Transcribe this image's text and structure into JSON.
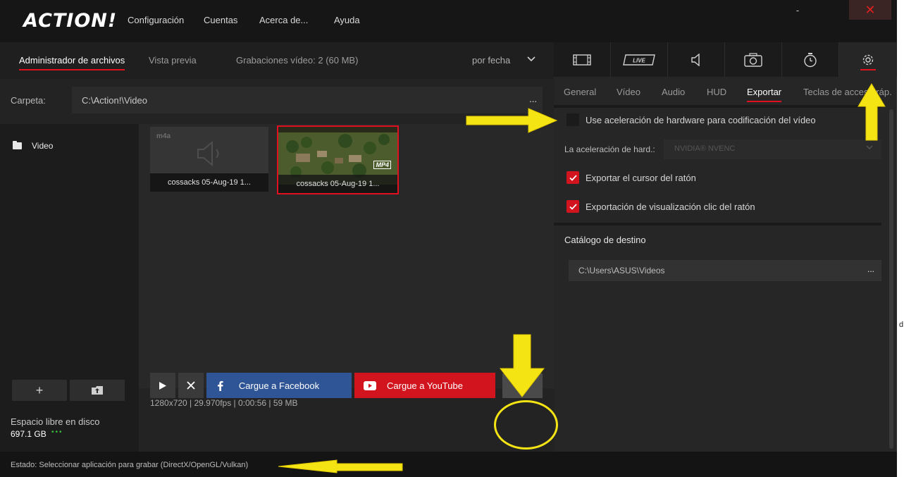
{
  "app": {
    "logo": "ACTION!"
  },
  "menu": [
    "Configuración",
    "Cuentas",
    "Acerca de...",
    "Ayuda"
  ],
  "window": {
    "minimize": "-",
    "close": "✕"
  },
  "left": {
    "tabs": {
      "files": "Administrador de archivos",
      "preview": "Vista previa"
    },
    "recordings_info": "Grabaciones vídeo: 2 (60 MB)",
    "sort": "por fecha",
    "folder_label": "Carpeta:",
    "folder_path": "C:\\Action!\\Video",
    "folder_dots": "...",
    "sidebar_item": "Video",
    "add_label": "+",
    "disk_label": "Espacio libre en disco",
    "disk_value": "697.1 GB",
    "disk_dots": "•••",
    "thumbs": [
      {
        "badge": "m4a",
        "caption": "cossacks 05-Aug-19 1..."
      },
      {
        "badge": "MP4",
        "caption": "cossacks 05-Aug-19 1..."
      }
    ],
    "file_info": "1280x720 | 29.970fps | 0:00:56 | 59 MB",
    "buttons": {
      "facebook": "Cargue a Facebook",
      "youtube": "Cargue a YouTube"
    }
  },
  "status": "Estado:   Seleccionar aplicación para grabar  (DirectX/OpenGL/Vulkan)",
  "right": {
    "icon_tabs": [
      "film-icon",
      "live-icon",
      "speaker-icon",
      "camera-icon",
      "timer-icon",
      "gear-icon"
    ],
    "live_label": "LIVE",
    "sub_tabs": [
      "General",
      "Vídeo",
      "Audio",
      "HUD",
      "Exportar",
      "Teclas de acceso ráp."
    ],
    "hw_accel_checkbox": "Use aceleración de hardware para codificación del vídeo",
    "hw_label": "La aceleración de hard.:",
    "hw_select": "NVIDIA® NVENC",
    "export_cursor": "Exportar el cursor del ratón",
    "export_click": "Exportación de visualización clic del ratón",
    "dest_title": "Catálogo de destino",
    "dest_path": "C:\\Users\\ASUS\\Videos",
    "dest_dots": "..."
  },
  "edge_char": "d",
  "colors": {
    "accent": "#e01020",
    "facebook": "#2f5596",
    "youtube": "#d2141e",
    "annotation": "#f5e414"
  }
}
